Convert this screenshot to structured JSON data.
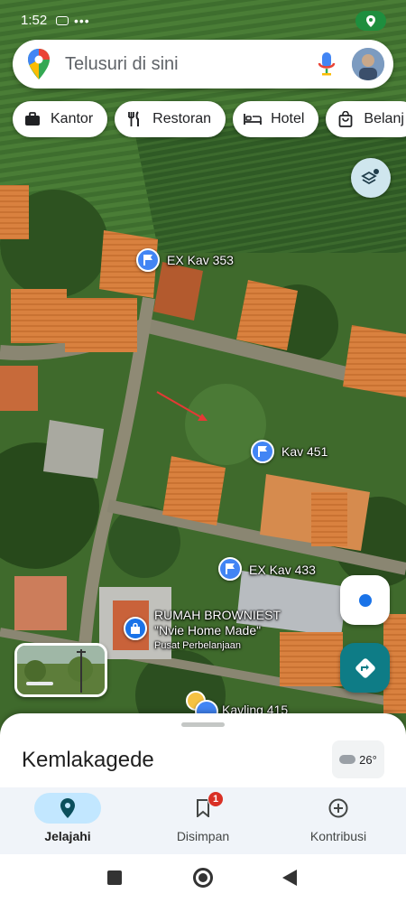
{
  "status_bar": {
    "time": "1:52",
    "location_active_color": "#1e8e3e"
  },
  "search": {
    "placeholder": "Telusuri di sini"
  },
  "chips": [
    {
      "label": "Kantor",
      "icon": "briefcase-icon"
    },
    {
      "label": "Restoran",
      "icon": "fork-knife-icon"
    },
    {
      "label": "Hotel",
      "icon": "bed-icon"
    },
    {
      "label": "Belanj",
      "icon": "shopping-bag-icon"
    }
  ],
  "map_markers": [
    {
      "label": "EX Kav 353",
      "type": "flag"
    },
    {
      "label": "Kav 451",
      "type": "flag"
    },
    {
      "label": "EX Kav 433",
      "type": "flag"
    },
    {
      "label": "RUMAH BROWNIEST",
      "subtitle_line": "\"Nvie Home Made\"",
      "category": "Pusat Perbelanjaan",
      "type": "shopping"
    },
    {
      "label": "Kavling 415",
      "type": "flag"
    }
  ],
  "sheet": {
    "place_title": "Kemlakagede",
    "weather": "26°"
  },
  "bottom_nav": {
    "items": [
      {
        "label": "Jelajahi",
        "icon": "location-pin-icon",
        "active": true
      },
      {
        "label": "Disimpan",
        "icon": "bookmark-icon",
        "badge": "1"
      },
      {
        "label": "Kontribusi",
        "icon": "add-circle-icon"
      }
    ]
  },
  "colors": {
    "accent_blue": "#4285f4",
    "active_nav_pill": "#c2e7ff",
    "directions_teal": "#0e7c86",
    "badge_red": "#d93025"
  }
}
